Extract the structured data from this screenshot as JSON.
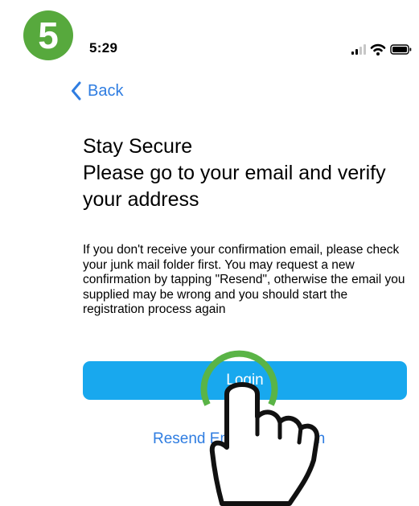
{
  "tutorial": {
    "step_number": "5"
  },
  "status_bar": {
    "time": "5:29",
    "icons": [
      "cellular-signal-icon",
      "wifi-icon",
      "battery-icon"
    ]
  },
  "nav": {
    "back_label": "Back"
  },
  "main": {
    "title_line1": "Stay Secure",
    "title_line2": "Please go to your email and verify your address",
    "description": "If you don't receive your confirmation email, please check your junk mail folder first.  You may request a new confirmation by tapping \"Resend\", otherwise the email you supplied may be wrong and you should start the registration process again",
    "login_button_label": "Login",
    "resend_link_label": "Resend Email verification"
  },
  "colors": {
    "accent_blue": "#2f7de1",
    "button_blue": "#18a8ee",
    "step_badge_green": "#57a93d",
    "tap_ring_green": "#5ab446"
  }
}
